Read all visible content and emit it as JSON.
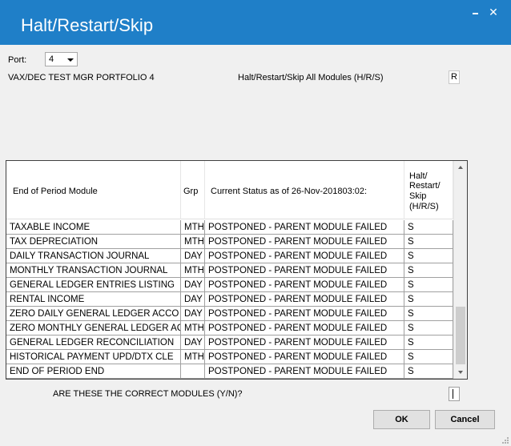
{
  "window": {
    "title": "Halt/Restart/Skip",
    "minimize_glyph": "minimize-icon",
    "close_glyph": "✕"
  },
  "form": {
    "port_label": "Port:",
    "port_value": "4",
    "company_label": "VAX/DEC TEST MGR PORTFOLIO 4",
    "all_modules_label": "Halt/Restart/Skip All Modules (H/R/S)",
    "all_modules_value": "R"
  },
  "grid": {
    "headers": {
      "module": "End of Period Module",
      "grp": "Grp",
      "status": "Current Status as of 26-Nov-201803:02:",
      "hrs": [
        "Halt/",
        "Restart/",
        "Skip",
        "(H/R/S)"
      ]
    },
    "rows": [
      {
        "module": "TAXABLE INCOME",
        "grp": "MTH",
        "status": "POSTPONED - PARENT MODULE FAILED",
        "hrs": "S"
      },
      {
        "module": "TAX DEPRECIATION",
        "grp": "MTH",
        "status": "POSTPONED - PARENT MODULE FAILED",
        "hrs": "S"
      },
      {
        "module": "DAILY TRANSACTION JOURNAL",
        "grp": "DAY",
        "status": "POSTPONED - PARENT MODULE FAILED",
        "hrs": "S"
      },
      {
        "module": "MONTHLY TRANSACTION JOURNAL",
        "grp": "MTH",
        "status": "POSTPONED - PARENT MODULE FAILED",
        "hrs": "S"
      },
      {
        "module": "GENERAL LEDGER ENTRIES LISTING",
        "grp": "DAY",
        "status": "POSTPONED - PARENT MODULE FAILED",
        "hrs": "S"
      },
      {
        "module": "RENTAL INCOME",
        "grp": "DAY",
        "status": "POSTPONED - PARENT MODULE FAILED",
        "hrs": "S"
      },
      {
        "module": "ZERO DAILY GENERAL LEDGER ACCO",
        "grp": "DAY",
        "status": "POSTPONED - PARENT MODULE FAILED",
        "hrs": "S"
      },
      {
        "module": "ZERO MONTHLY GENERAL LEDGER AC",
        "grp": "MTH",
        "status": "POSTPONED - PARENT MODULE FAILED",
        "hrs": "S"
      },
      {
        "module": "GENERAL LEDGER RECONCILIATION",
        "grp": "DAY",
        "status": "POSTPONED - PARENT MODULE FAILED",
        "hrs": "S"
      },
      {
        "module": "HISTORICAL PAYMENT UPD/DTX CLE",
        "grp": "MTH",
        "status": "POSTPONED - PARENT MODULE FAILED",
        "hrs": "S"
      },
      {
        "module": "END OF PERIOD END",
        "grp": "",
        "status": "POSTPONED - PARENT MODULE FAILED",
        "hrs": "S"
      }
    ]
  },
  "confirm": {
    "question": "ARE THESE THE CORRECT MODULES (Y/N)?",
    "value": ""
  },
  "buttons": {
    "ok": "OK",
    "cancel": "Cancel"
  },
  "colors": {
    "titlebar": "#1f7fc8",
    "background": "#f0f0f0"
  }
}
